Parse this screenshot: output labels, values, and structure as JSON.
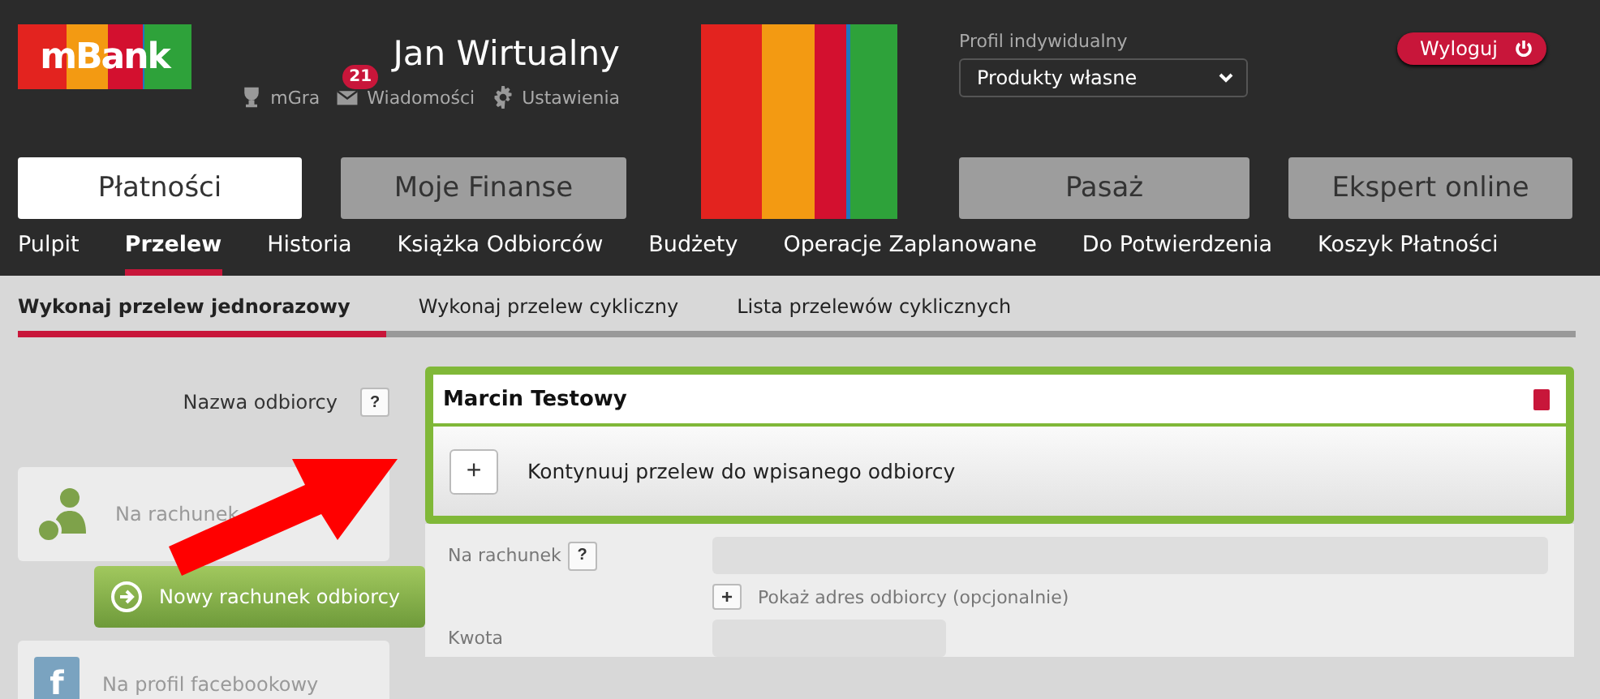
{
  "header": {
    "logo": "mBank",
    "user_name": "Jan Wirtualny",
    "links": [
      {
        "kind": "trophy",
        "label": "mGra"
      },
      {
        "kind": "mail",
        "label": "Wiadomości",
        "badge": "21"
      },
      {
        "kind": "gear",
        "label": "Ustawienia"
      }
    ],
    "profile": {
      "label": "Profil indywidualny",
      "value": "Produkty własne"
    },
    "logout": "Wyloguj"
  },
  "main_tabs": [
    {
      "label": "Płatności",
      "selected": true
    },
    {
      "label": "Moje Finanse",
      "selected": false
    },
    {
      "label": "Pasaż",
      "selected": false
    },
    {
      "label": "Ekspert online",
      "selected": false
    }
  ],
  "nav": [
    {
      "label": "Pulpit",
      "selected": false
    },
    {
      "label": "Przelew",
      "selected": true
    },
    {
      "label": "Historia",
      "selected": false
    },
    {
      "label": "Książka Odbiorców",
      "selected": false
    },
    {
      "label": "Budżety",
      "selected": false
    },
    {
      "label": "Operacje Zaplanowane",
      "selected": false
    },
    {
      "label": "Do Potwierdzenia",
      "selected": false
    },
    {
      "label": "Koszyk Płatności",
      "selected": false
    }
  ],
  "sub_tabs": [
    {
      "label": "Wykonaj przelew jednorazowy",
      "selected": true
    },
    {
      "label": "Wykonaj przelew cykliczny",
      "selected": false
    },
    {
      "label": "Lista przelewów cyklicznych",
      "selected": false
    }
  ],
  "sidebar": {
    "account_card": "Na rachunek",
    "new_button": "Nowy rachunek odbiorcy",
    "facebook_mark": "f",
    "facebook_card": "Na profil facebookowy"
  },
  "form": {
    "recipient_label": "Nazwa odbiorcy",
    "help": "?",
    "recipient_value": "Marcin Testowy",
    "suggestion_add": "+",
    "suggestion": "Kontynuuj przelew do wpisanego odbiorcy",
    "account_label": "Na rachunek",
    "account_help": "?",
    "address_add": "+",
    "address_link": "Pokaż adres odbiorcy (opcjonalnie)",
    "amount_label": "Kwota"
  }
}
